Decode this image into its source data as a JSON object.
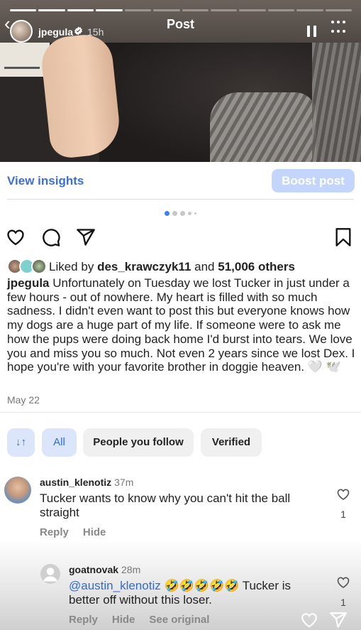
{
  "story": {
    "title": "Post",
    "username": "jpegula",
    "time": "15h",
    "progress_segments": 12,
    "progress_done": 4
  },
  "insights": {
    "view_insights": "View insights",
    "boost_post": "Boost post"
  },
  "likes": {
    "prefix": "Liked by",
    "user": "des_krawczyk11",
    "and": "and",
    "others": "51,006 others"
  },
  "caption": {
    "username": "jpegula",
    "text": "Unfortunately on Tuesday we lost Tucker in just under a few hours - out of nowhere. My heart is filled with so much sadness. I didn't even want to post this but everyone knows how my dogs are a huge part of my life. If someone were to ask me how the pups were doing back home I'd burst into tears. We love you and miss you so much. Not even 2 years since we lost Dex. I hope you're with your favorite brother in doggie heaven. 🤍 🕊️",
    "date": "May 22"
  },
  "filters": {
    "sort_icon": "↓↑",
    "all": "All",
    "people_you_follow": "People you follow",
    "verified": "Verified"
  },
  "comments": [
    {
      "username": "austin_klenotiz",
      "time": "37m",
      "text": "Tucker wants to know why you can't hit the ball straight",
      "likes": "1",
      "reply": "Reply",
      "hide": "Hide"
    },
    {
      "username": "goatnovak",
      "time": "28m",
      "mention": "@austin_klenotiz",
      "emojis": "🤣🤣🤣🤣🤣",
      "text": " Tucker is better off without this loser.",
      "likes": "1",
      "reply": "Reply",
      "hide": "Hide",
      "see_original": "See original"
    }
  ],
  "colors": {
    "link_blue": "#3b6ed6",
    "boost_bg": "#c4d5fb",
    "chip_active_bg": "#dbe6fb"
  }
}
